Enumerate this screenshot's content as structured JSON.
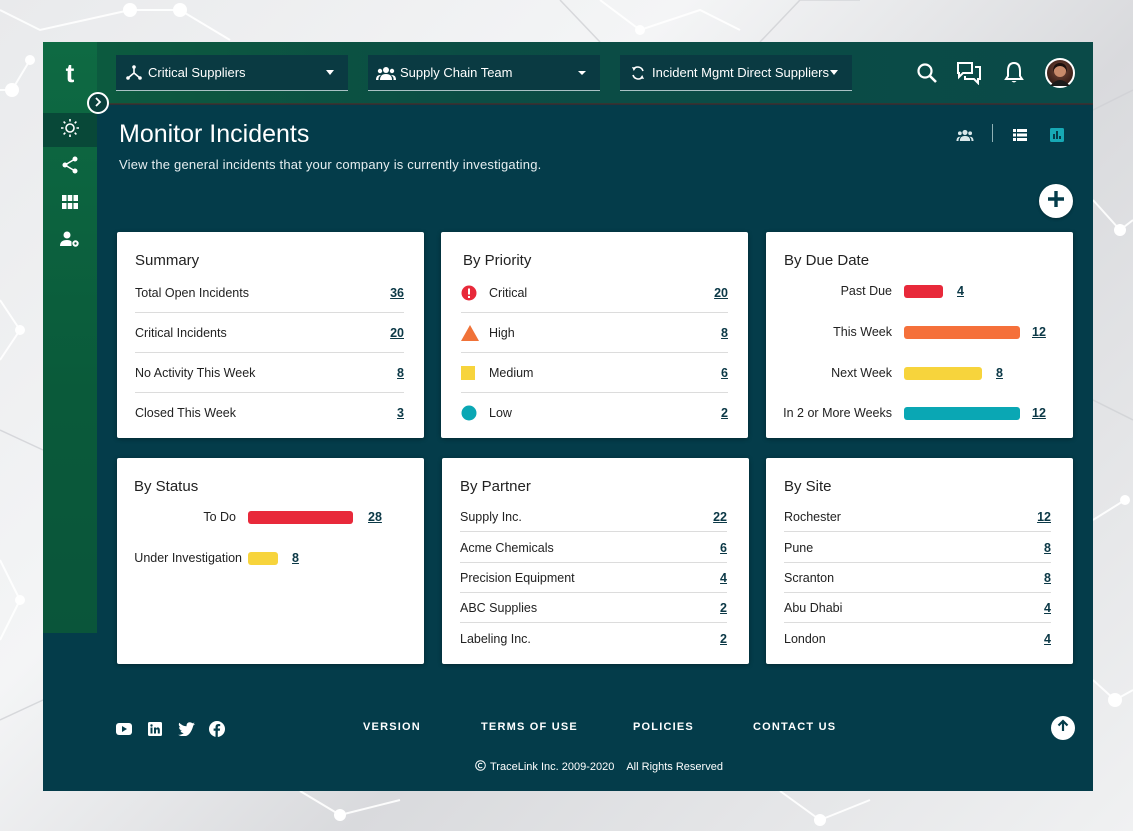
{
  "app": {
    "logo": "t"
  },
  "header": {
    "dropdowns": [
      {
        "label": "Critical Suppliers",
        "icon": "hierarchy-icon"
      },
      {
        "label": "Supply Chain Team",
        "icon": "team-icon"
      },
      {
        "label": "Incident Mgmt Direct Suppliers",
        "icon": "sync-icon"
      }
    ],
    "icons": [
      "search-icon",
      "chat-icon",
      "bell-icon",
      "avatar"
    ]
  },
  "sidebar": {
    "items": [
      "lightbulb-icon",
      "share-icon",
      "grid-icon",
      "user-settings-icon"
    ]
  },
  "main": {
    "title": "Monitor Incidents",
    "subtitle": "View the general incidents that your company is currently investigating.",
    "view_icons": [
      "people-icon",
      "list-view-icon",
      "chart-view-icon"
    ]
  },
  "summary": {
    "title": "Summary",
    "rows": [
      {
        "label": "Total Open Incidents",
        "value": "36"
      },
      {
        "label": "Critical Incidents",
        "value": "20"
      },
      {
        "label": "No Activity This Week",
        "value": "8"
      },
      {
        "label": "Closed This Week",
        "value": "3"
      }
    ]
  },
  "priority": {
    "title": "By Priority",
    "rows": [
      {
        "label": "Critical",
        "value": "20",
        "color": "#e8293a",
        "shape": "circle-alert"
      },
      {
        "label": "High",
        "value": "8",
        "color": "#f07238",
        "shape": "triangle"
      },
      {
        "label": "Medium",
        "value": "6",
        "color": "#f7d43c",
        "shape": "square"
      },
      {
        "label": "Low",
        "value": "2",
        "color": "#0aa7b4",
        "shape": "circle"
      }
    ]
  },
  "due_date": {
    "title": "By Due Date",
    "rows": [
      {
        "label": "Past Due",
        "value": "4",
        "color": "#e8293a"
      },
      {
        "label": "This Week",
        "value": "12",
        "color": "#f5703a"
      },
      {
        "label": "Next Week",
        "value": "8",
        "color": "#f7d43c"
      },
      {
        "label": "In 2 or More Weeks",
        "value": "12",
        "color": "#0aa7b4"
      }
    ]
  },
  "status": {
    "title": "By Status",
    "rows": [
      {
        "label": "To Do",
        "value": "28",
        "color": "#e8293a"
      },
      {
        "label": "Under Investigation",
        "value": "8",
        "color": "#f7d43c"
      }
    ]
  },
  "partner": {
    "title": "By Partner",
    "rows": [
      {
        "label": "Supply Inc.",
        "value": "22"
      },
      {
        "label": "Acme Chemicals",
        "value": "6"
      },
      {
        "label": "Precision Equipment",
        "value": "4"
      },
      {
        "label": "ABC Supplies",
        "value": "2"
      },
      {
        "label": "Labeling Inc.",
        "value": "2"
      }
    ]
  },
  "site": {
    "title": "By Site",
    "rows": [
      {
        "label": "Rochester",
        "value": "12"
      },
      {
        "label": "Pune",
        "value": "8"
      },
      {
        "label": "Scranton",
        "value": "8"
      },
      {
        "label": "Abu Dhabi",
        "value": "4"
      },
      {
        "label": "London",
        "value": "4"
      }
    ]
  },
  "footer": {
    "social": [
      "youtube-icon",
      "linkedin-icon",
      "twitter-icon",
      "facebook-icon"
    ],
    "links": [
      "VERSION",
      "TERMS OF USE",
      "POLICIES",
      "CONTACT US"
    ],
    "copyright": "TraceLink Inc. 2009-2020",
    "rights": "All Rights Reserved"
  },
  "colors": {
    "app_bg": "#043c4a",
    "header_green": "#0c5c3e",
    "link": "#0b3846"
  }
}
